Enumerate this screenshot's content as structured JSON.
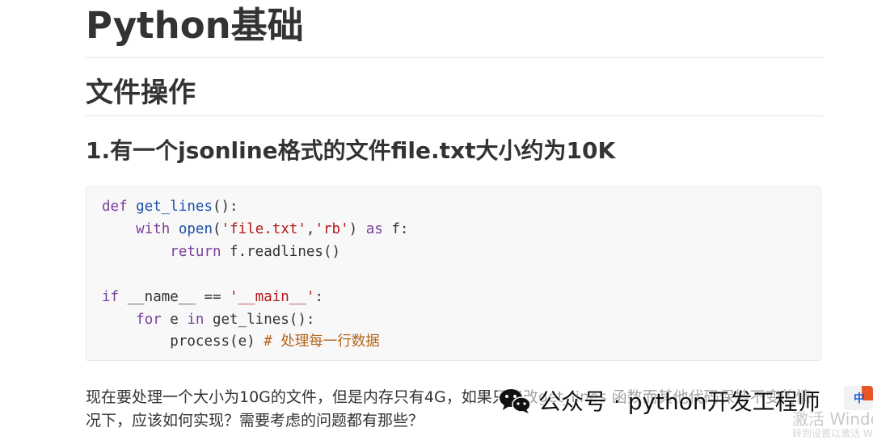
{
  "title": "Python基础",
  "section": "文件操作",
  "question": "1.有一个jsonline格式的文件file.txt大小约为10K",
  "code": {
    "line1": {
      "kw": "def",
      "fn": "get_lines",
      "rest": "():"
    },
    "line2": {
      "indent": "    ",
      "kw1": "with",
      "fn": "open",
      "p1": "(",
      "s1": "'file.txt'",
      "p2": ",",
      "s2": "'rb'",
      "p3": ") ",
      "kw2": "as",
      "rest": " f:"
    },
    "line3": {
      "indent": "        ",
      "kw": "return",
      "rest": " f.readlines()"
    },
    "line4": {
      "kw": "if",
      "mid": " __name__ == ",
      "s": "'__main__'",
      "rest": ":"
    },
    "line5": {
      "indent": "    ",
      "kw1": "for",
      "mid": " e ",
      "kw2": "in",
      "rest": " get_lines():"
    },
    "line6": {
      "indent": "        ",
      "code": "process(e) ",
      "comment": "# 处理每一行数据"
    }
  },
  "paragraph": "现在要处理一个大小为10G的文件，但是内存只有4G，如果只修改get_lines 函数而其他代码保持不变的情况下，应该如何实现？需要考虑的问题都有那些？",
  "watermark": {
    "text": "公众号 · python开发工程师",
    "icon": "wechat-icon"
  },
  "ime": {
    "label": "中"
  },
  "activation": {
    "text": "激活 Windows",
    "sub": "转到设置以激活 Windows"
  },
  "colors": {
    "keyword": "#7a3e9d",
    "function": "#1f4ea6",
    "string": "#b21818",
    "comment": "#b5651d",
    "code_bg": "#f8f8f8"
  }
}
